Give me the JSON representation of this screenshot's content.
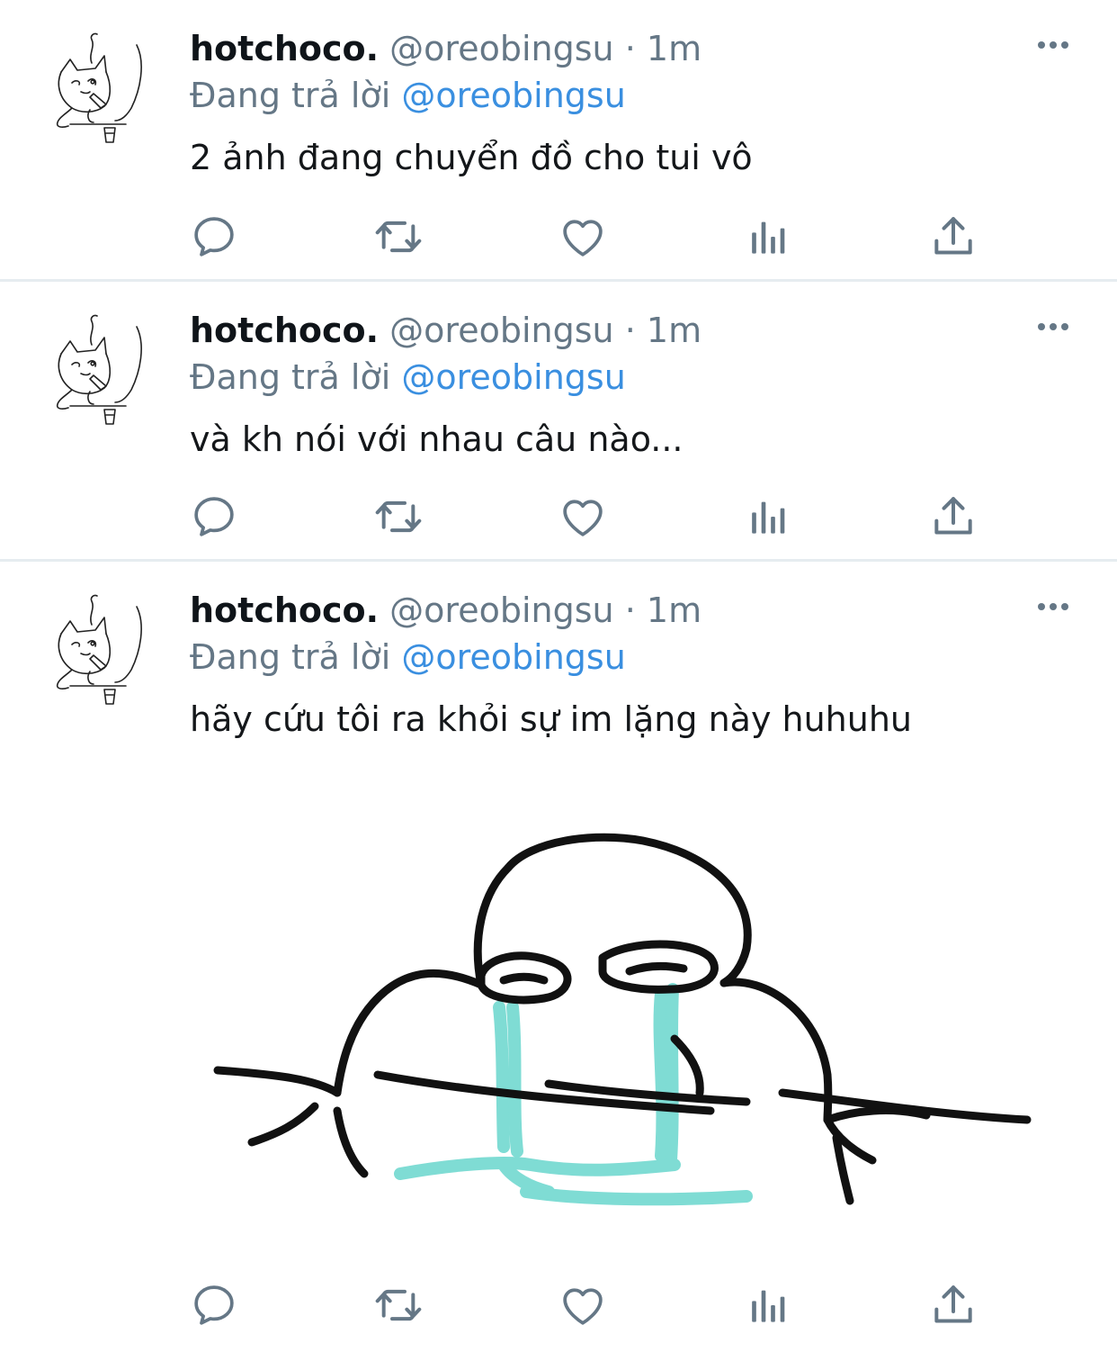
{
  "tweets": [
    {
      "display_name": "hotchoco.",
      "handle": "@oreobingsu",
      "separator": "·",
      "time": "1m",
      "reply_prefix": "Đang trả lời",
      "reply_to": "@oreobingsu",
      "text": "2 ảnh đang chuyển đồ cho tui vô"
    },
    {
      "display_name": "hotchoco.",
      "handle": "@oreobingsu",
      "separator": "·",
      "time": "1m",
      "reply_prefix": "Đang trả lời",
      "reply_to": "@oreobingsu",
      "text": "và kh nói với nhau câu nào..."
    },
    {
      "display_name": "hotchoco.",
      "handle": "@oreobingsu",
      "separator": "·",
      "time": "1m",
      "reply_prefix": "Đang trả lời",
      "reply_to": "@oreobingsu",
      "text": "hãy cứu tôi ra khỏi sự im lặng này huhuhu",
      "media": "crying-doodle-image"
    }
  ],
  "icons": {
    "reply": "reply-icon",
    "retweet": "retweet-icon",
    "like": "like-icon",
    "analytics": "analytics-icon",
    "share": "share-icon",
    "more": "more-options-icon"
  },
  "colors": {
    "text": "#14171a",
    "secondary": "#657786",
    "link": "#3a8fe0",
    "divider": "#e6ecf0",
    "tears": "#7fdcd4"
  }
}
